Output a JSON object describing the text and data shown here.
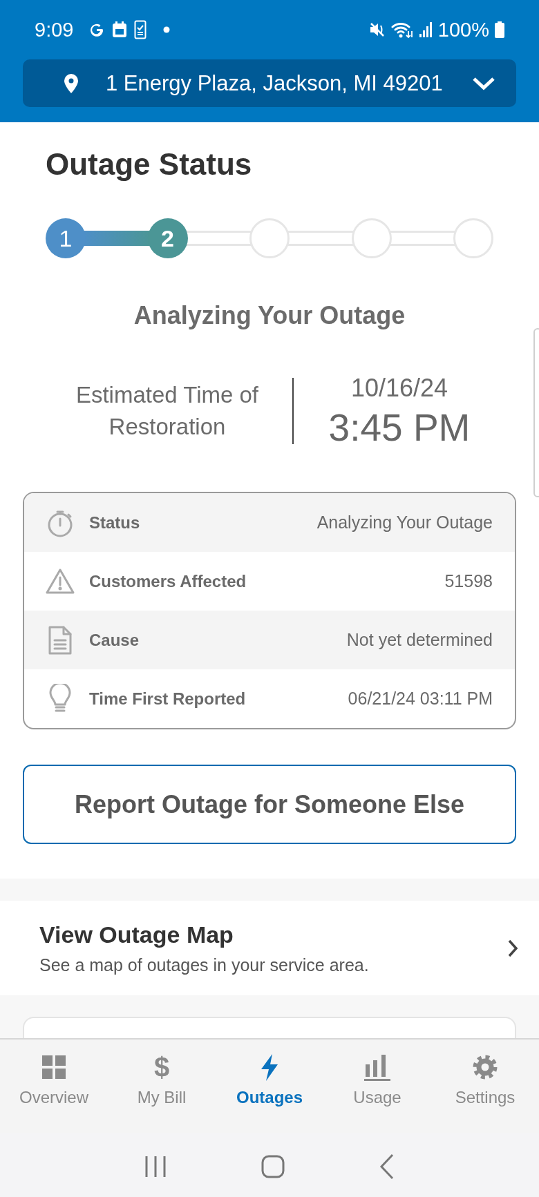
{
  "status_bar": {
    "time": "9:09",
    "battery": "100%"
  },
  "address": {
    "text": "1 Energy Plaza, Jackson, MI 49201"
  },
  "title": "Outage Status",
  "steps": [
    {
      "label": "1",
      "completed": true,
      "active": false
    },
    {
      "label": "2",
      "completed": false,
      "active": true
    },
    {
      "completed": false,
      "active": false
    },
    {
      "completed": false,
      "active": false
    },
    {
      "completed": false,
      "active": false
    }
  ],
  "stage": "Analyzing Your Outage",
  "restoration": {
    "label": "Estimated Time of Restoration",
    "date": "10/16/24",
    "time": "3:45 PM"
  },
  "details": [
    {
      "label": "Status",
      "value": "Analyzing Your Outage"
    },
    {
      "label": "Customers Affected",
      "value": "51598"
    },
    {
      "label": "Cause",
      "value": "Not yet determined"
    },
    {
      "label": "Time First Reported",
      "value": "06/21/24 03:11 PM"
    }
  ],
  "report_button": "Report Outage for Someone Else",
  "map_link": {
    "title": "View Outage Map",
    "subtitle": "See a map of outages in your service area."
  },
  "nav": [
    {
      "label": "Overview",
      "selected": false
    },
    {
      "label": "My Bill",
      "glyph": "$",
      "selected": false
    },
    {
      "label": "Outages",
      "selected": true
    },
    {
      "label": "Usage",
      "selected": false
    },
    {
      "label": "Settings",
      "selected": false
    }
  ]
}
